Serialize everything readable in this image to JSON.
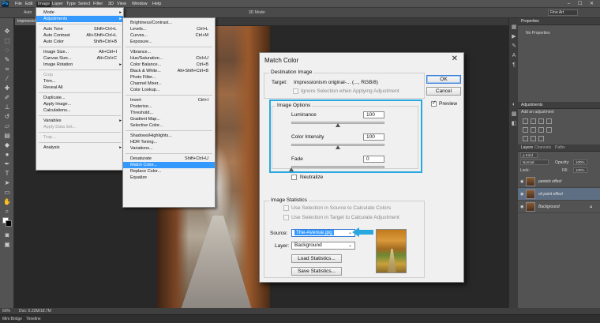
{
  "app": {
    "logo": "Ps"
  },
  "menubar": {
    "items": [
      "File",
      "Edit",
      "Image",
      "Layer",
      "Type",
      "Select",
      "Filter",
      "3D",
      "View",
      "Window",
      "Help"
    ],
    "active": "Image",
    "window_controls": "–  ☐  ✕"
  },
  "options_bar": {
    "auto_label": "Auto",
    "mode_3d": "3D Mode:",
    "workspace": "Fine Art"
  },
  "document": {
    "tab_label": "Impressionism"
  },
  "image_menu": {
    "items": [
      {
        "label": "Mode",
        "shortcut": "",
        "submenu": true,
        "state": "normal"
      },
      {
        "label": "Adjustments",
        "shortcut": "",
        "submenu": true,
        "state": "highlight"
      },
      {
        "label": "Auto Tone",
        "shortcut": "Shift+Ctrl+L",
        "state": "normal"
      },
      {
        "label": "Auto Contrast",
        "shortcut": "Alt+Shift+Ctrl+L",
        "state": "normal"
      },
      {
        "label": "Auto Color",
        "shortcut": "Shift+Ctrl+B",
        "state": "normal"
      },
      {
        "label": "Image Size...",
        "shortcut": "Alt+Ctrl+I",
        "state": "normal"
      },
      {
        "label": "Canvas Size...",
        "shortcut": "Alt+Ctrl+C",
        "state": "normal"
      },
      {
        "label": "Image Rotation",
        "shortcut": "",
        "submenu": true,
        "state": "normal"
      },
      {
        "label": "Crop",
        "shortcut": "",
        "state": "disabled"
      },
      {
        "label": "Trim...",
        "shortcut": "",
        "state": "normal"
      },
      {
        "label": "Reveal All",
        "shortcut": "",
        "state": "normal"
      },
      {
        "label": "Duplicate...",
        "shortcut": "",
        "state": "normal"
      },
      {
        "label": "Apply Image...",
        "shortcut": "",
        "state": "normal"
      },
      {
        "label": "Calculations...",
        "shortcut": "",
        "state": "normal"
      },
      {
        "label": "Variables",
        "shortcut": "",
        "submenu": true,
        "state": "normal"
      },
      {
        "label": "Apply Data Set...",
        "shortcut": "",
        "state": "disabled"
      },
      {
        "label": "Trap...",
        "shortcut": "",
        "state": "disabled"
      },
      {
        "label": "Analysis",
        "shortcut": "",
        "submenu": true,
        "state": "normal"
      }
    ]
  },
  "adjustments_menu": {
    "items": [
      {
        "label": "Brightness/Contrast...",
        "shortcut": "",
        "state": "normal"
      },
      {
        "label": "Levels...",
        "shortcut": "Ctrl+L",
        "state": "normal"
      },
      {
        "label": "Curves...",
        "shortcut": "Ctrl+M",
        "state": "normal"
      },
      {
        "label": "Exposure...",
        "shortcut": "",
        "state": "normal"
      },
      {
        "label": "Vibrance...",
        "shortcut": "",
        "state": "normal"
      },
      {
        "label": "Hue/Saturation...",
        "shortcut": "Ctrl+U",
        "state": "normal"
      },
      {
        "label": "Color Balance...",
        "shortcut": "Ctrl+B",
        "state": "normal"
      },
      {
        "label": "Black & White...",
        "shortcut": "Alt+Shift+Ctrl+B",
        "state": "normal"
      },
      {
        "label": "Photo Filter...",
        "shortcut": "",
        "state": "normal"
      },
      {
        "label": "Channel Mixer...",
        "shortcut": "",
        "state": "normal"
      },
      {
        "label": "Color Lookup...",
        "shortcut": "",
        "state": "normal"
      },
      {
        "label": "Invert",
        "shortcut": "Ctrl+I",
        "state": "normal"
      },
      {
        "label": "Posterize...",
        "shortcut": "",
        "state": "normal"
      },
      {
        "label": "Threshold...",
        "shortcut": "",
        "state": "normal"
      },
      {
        "label": "Gradient Map...",
        "shortcut": "",
        "state": "normal"
      },
      {
        "label": "Selective Color...",
        "shortcut": "",
        "state": "normal"
      },
      {
        "label": "Shadows/Highlights...",
        "shortcut": "",
        "state": "normal"
      },
      {
        "label": "HDR Toning...",
        "shortcut": "",
        "state": "normal"
      },
      {
        "label": "Variations...",
        "shortcut": "",
        "state": "normal"
      },
      {
        "label": "Desaturate",
        "shortcut": "Shift+Ctrl+U",
        "state": "normal"
      },
      {
        "label": "Match Color...",
        "shortcut": "",
        "state": "highlight"
      },
      {
        "label": "Replace Color...",
        "shortcut": "",
        "state": "normal"
      },
      {
        "label": "Equalize",
        "shortcut": "",
        "state": "normal"
      }
    ]
  },
  "match_color_dialog": {
    "title": "Match Color",
    "close": "✕",
    "destination": {
      "group_title": "Destination Image",
      "target_label": "Target:",
      "target_value": "Impressionism original-... (..., RGB/8)",
      "ignore_selection": "Ignore Selection when Applying Adjustment"
    },
    "image_options": {
      "group_title": "Image Options",
      "luminance_label": "Luminance",
      "luminance_value": "100",
      "luminance_level": 0.5,
      "color_intensity_label": "Color Intensity",
      "color_intensity_value": "100",
      "color_intensity_level": 0.5,
      "fade_label": "Fade",
      "fade_value": "0",
      "fade_level": 0,
      "neutralize": "Neutralize"
    },
    "image_statistics": {
      "group_title": "Image Statistics",
      "use_selection_source": "Use Selection in Source to Calculate Colors",
      "use_selection_target": "Use Selection in Target to Calculate Adjustment",
      "source_label": "Source:",
      "source_value": "The-Avenue.jpg",
      "layer_label": "Layer:",
      "layer_value": "Background",
      "load_stats": "Load Statistics...",
      "save_stats": "Save Statistics..."
    },
    "buttons": {
      "ok": "OK",
      "cancel": "Cancel",
      "preview": "Preview"
    },
    "colors": {
      "highlight_box": "#29a8e0",
      "arrow": "#29a8e0"
    }
  },
  "properties_panel": {
    "tab": "Properties",
    "message": "No Properties"
  },
  "adjustments_panel": {
    "tab": "Adjustments",
    "title": "Add an adjustment"
  },
  "layers_panel": {
    "tabs": [
      "Layers",
      "Channels",
      "Paths"
    ],
    "kind": "ρ Kind",
    "blend_mode": "Normal",
    "opacity_label": "Opacity:",
    "opacity_value": "100%",
    "lock_label": "Lock:",
    "fill_label": "Fill:",
    "fill_value": "100%",
    "layers": [
      {
        "name": "pastels effect",
        "selected": false,
        "locked": false
      },
      {
        "name": "oil paint effect",
        "selected": true,
        "locked": false
      },
      {
        "name": "Background",
        "selected": false,
        "locked": true
      }
    ]
  },
  "status_bar": {
    "zoom": "50%",
    "doc": "Doc: 6.22M/18.7M"
  },
  "bottom_tabs": [
    "Mini Bridge",
    "Timeline"
  ]
}
